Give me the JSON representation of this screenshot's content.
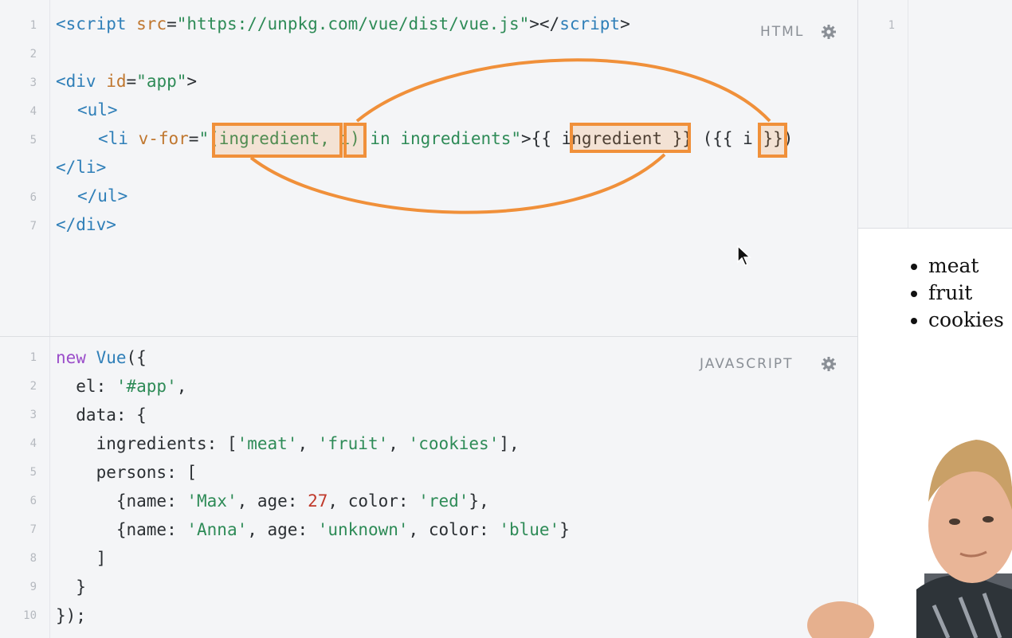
{
  "html_panel": {
    "label": "HTML",
    "line_numbers": [
      "1",
      "2",
      "3",
      "4",
      "5",
      "6",
      "7"
    ],
    "line1": {
      "open_tag": "<script",
      "attr": " src",
      "eq": "=",
      "val": "\"https://unpkg.com/vue/dist/vue.js\"",
      "close": "></",
      "close_tag": "script",
      "end": ">"
    },
    "line3": {
      "open": "<div",
      "attr": " id",
      "eq": "=",
      "val": "\"app\"",
      "end": ">"
    },
    "line4": {
      "text": "<ul>"
    },
    "line5": {
      "open": "<li",
      "attr": " v-for",
      "eq": "=",
      "val": "\"(ingredient, i) in ingredients\"",
      "rest": ">{{ ingredient }} ({{ i }})"
    },
    "line5b": {
      "text": "</li>"
    },
    "line6": {
      "text": "</ul>"
    },
    "line7": {
      "text": "</div>"
    }
  },
  "js_panel": {
    "label": "JAVASCRIPT",
    "line_numbers": [
      "1",
      "2",
      "3",
      "4",
      "5",
      "6",
      "7",
      "8",
      "9",
      "10"
    ],
    "l1_kw": "new",
    "l1_cls": " Vue",
    "l1_rest": "({",
    "l2_key": "  el: ",
    "l2_str": "'#app'",
    "l2_end": ",",
    "l3": "  data: {",
    "l4_key": "    ingredients: [",
    "l4_s1": "'meat'",
    "l4_c1": ", ",
    "l4_s2": "'fruit'",
    "l4_c2": ", ",
    "l4_s3": "'cookies'",
    "l4_end": "],",
    "l5": "    persons: [",
    "l6_a": "      {name: ",
    "l6_s1": "'Max'",
    "l6_b": ", age: ",
    "l6_n": "27",
    "l6_c": ", color: ",
    "l6_s2": "'red'",
    "l6_end": "},",
    "l7_a": "      {name: ",
    "l7_s1": "'Anna'",
    "l7_b": ", age: ",
    "l7_s2": "'unknown'",
    "l7_c": ", color: ",
    "l7_s3": "'blue'",
    "l7_end": "}",
    "l8": "    ]",
    "l9": "  }",
    "l10": "});"
  },
  "css_panel": {
    "line_numbers": [
      "1"
    ]
  },
  "output": {
    "items": [
      "meat",
      "fruit",
      "cookies"
    ]
  },
  "colors": {
    "highlight": "#f0903a",
    "tag": "#2f7fb8",
    "string": "#2e8b57",
    "keyword": "#9b4dca",
    "number": "#c0392b"
  }
}
